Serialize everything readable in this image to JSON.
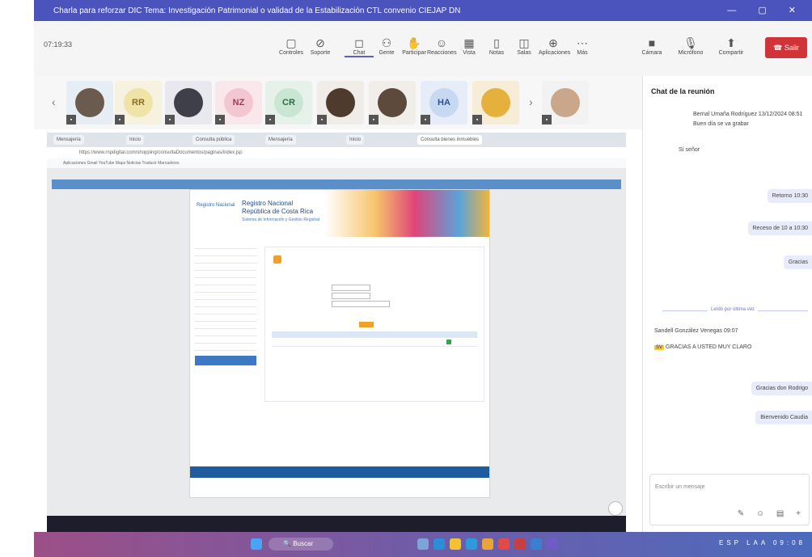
{
  "window": {
    "title": "Charla para reforzar DIC Tema: Investigación Patrimonial o validad de la Estabilización CTL convenio CIEJAP DN",
    "controls": "— ▢ ✕"
  },
  "meeting": {
    "timer": "07:19:33",
    "toolbar": [
      {
        "label": "Controles",
        "icon": "▢"
      },
      {
        "label": "Soporte",
        "icon": "⊘"
      },
      {
        "label": "Chat",
        "icon": "◻"
      },
      {
        "label": "Gente",
        "icon": "⚇"
      },
      {
        "label": "Participar",
        "icon": "✋"
      },
      {
        "label": "Reacciones",
        "icon": "☺"
      },
      {
        "label": "Vista",
        "icon": "▦"
      },
      {
        "label": "Notas",
        "icon": "▯"
      },
      {
        "label": "Salas",
        "icon": "◫"
      },
      {
        "label": "Aplicaciones",
        "icon": "⊕"
      },
      {
        "label": "Más",
        "icon": "⋯"
      },
      {
        "label": "Cámara",
        "icon": "■"
      },
      {
        "label": "Micrófono",
        "icon": "🎙"
      },
      {
        "label": "Compartir",
        "icon": "⬆"
      }
    ],
    "leave_label": "Salir"
  },
  "participants": [
    {
      "initials": "",
      "bg": "#e7edf5",
      "avatar": "#6b5a4e",
      "type": "photo"
    },
    {
      "initials": "RR",
      "bg": "#f6f2df",
      "avatar": "#efe3a8",
      "type": "initials",
      "color": "#8a6d1f"
    },
    {
      "initials": "",
      "bg": "#e8e8ee",
      "avatar": "#3f3f4a",
      "type": "photo"
    },
    {
      "initials": "NZ",
      "bg": "#f8e8ec",
      "avatar": "#f3c7d2",
      "type": "initials",
      "color": "#a03b5a"
    },
    {
      "initials": "CR",
      "bg": "#e6f1ea",
      "avatar": "#c9e6d2",
      "type": "initials",
      "color": "#2f6a45"
    },
    {
      "initials": "",
      "bg": "#f0ece7",
      "avatar": "#4f3b2e",
      "type": "photo"
    },
    {
      "initials": "",
      "bg": "#f1eee9",
      "avatar": "#5e4a3c",
      "type": "photo"
    },
    {
      "initials": "HA",
      "bg": "#e6edf8",
      "avatar": "#c6d8f2",
      "type": "initials",
      "color": "#2e5394"
    },
    {
      "initials": "",
      "bg": "#f7ecd6",
      "avatar": "#e6b03c",
      "type": "photo"
    },
    {
      "initials": "",
      "bg": "#f2f2f2",
      "avatar": "#caa68a",
      "type": "photo"
    }
  ],
  "browser": {
    "tabs": [
      "Mensajería",
      "Inicio",
      "Consulta pública",
      "Mensajería",
      "Inicio",
      "Consulta bienes inmuebles"
    ],
    "url": "https://www.rnpdigital.com/shopping/consultaDocumentos/paginas/index.jsp",
    "bookmarks": "Aplicaciones   Gmail   YouTube   Maps   Noticias   Traducir   Marcadores"
  },
  "registry": {
    "title_line1": "Registro Nacional",
    "title_line2": "República de Costa Rica",
    "subtitle": "Sistema de Información y Gestión Registral",
    "logo_text": "Registro Nacional"
  },
  "chat": {
    "title": "Chat de la reunión",
    "msg1_author": "Bernal Umaña Rodríguez   13/12/2024 08:51",
    "msg1_text": "Buen día se va grabar",
    "msg2_text": "Sí señor",
    "bubble1": "Retorno 10:30",
    "bubble2": "Receso de 10 a 10:30",
    "bubble3": "Gracias",
    "divider": "Leído por última vez",
    "msg3_author": "Sandell González Venegas   09:07",
    "msg3_text": "GRACIAS A USTED MUY CLARO",
    "bubble4": "Gracias don Rodrigo",
    "bubble5": "Bienvenido Caudia",
    "compose_placeholder": "Escribir un mensaje",
    "compose_icons": "✎ ☺ ▤ +"
  },
  "taskbar": {
    "search": "Buscar",
    "tray": "ESP LAA 09:08"
  }
}
